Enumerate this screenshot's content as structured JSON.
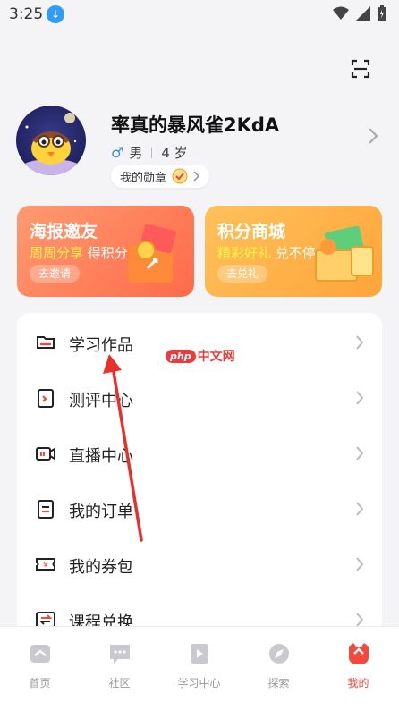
{
  "status_bar": {
    "time": "3:25",
    "download_icon": "download-icon",
    "icons": [
      "wifi-icon",
      "signal-icon",
      "battery-icon"
    ]
  },
  "header": {
    "scan_icon": "scan-icon"
  },
  "profile": {
    "name": "率真的暴风雀2KdA",
    "gender": "男",
    "age": "4 岁",
    "badge_label": "我的勋章"
  },
  "promos": [
    {
      "title": "海报邀友",
      "sub_highlight": "周周分享",
      "sub_rest": "得积分",
      "button": "去邀请",
      "color": "#ff7a55"
    },
    {
      "title": "积分商城",
      "sub_highlight": "精彩好礼",
      "sub_rest": "兑不停",
      "button": "去兑礼",
      "color": "#ffb040"
    }
  ],
  "menu": [
    {
      "label": "学习作品",
      "icon": "folder-icon"
    },
    {
      "label": "测评中心",
      "icon": "assessment-icon"
    },
    {
      "label": "直播中心",
      "icon": "live-video-icon"
    },
    {
      "label": "我的订单",
      "icon": "order-icon"
    },
    {
      "label": "我的券包",
      "icon": "coupon-icon"
    },
    {
      "label": "课程兑换",
      "icon": "exchange-icon"
    }
  ],
  "watermark": {
    "logo": "php",
    "text": "中文网"
  },
  "tabs": [
    {
      "label": "首页",
      "icon": "home-icon",
      "active": false
    },
    {
      "label": "社区",
      "icon": "community-icon",
      "active": false
    },
    {
      "label": "学习中心",
      "icon": "study-center-icon",
      "active": false
    },
    {
      "label": "探索",
      "icon": "explore-icon",
      "active": false
    },
    {
      "label": "我的",
      "icon": "profile-tab-icon",
      "active": true
    }
  ],
  "colors": {
    "accent": "#f24a3c",
    "background": "#f4f4f6",
    "annotation_arrow": "#e8302a"
  }
}
